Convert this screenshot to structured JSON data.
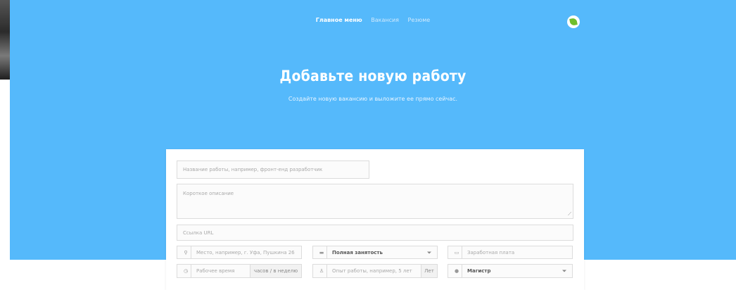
{
  "nav": {
    "items": [
      {
        "label": "Главное меню",
        "active": true
      },
      {
        "label": "Вакансия",
        "active": false
      },
      {
        "label": "Резюме",
        "active": false
      }
    ]
  },
  "logo": {
    "icon": "leaf-icon",
    "color": "#6fbe2c"
  },
  "hero": {
    "title": "Добавьте новую работу",
    "subtitle": "Создайте новую вакансию и выложите ее прямо сейчас.",
    "background": "#55b9fb"
  },
  "form": {
    "job_title": {
      "placeholder": "Название работы, например, фронт-енд разработчик"
    },
    "short_description": {
      "placeholder": "Короткое описание"
    },
    "url": {
      "placeholder": "Ссылка URL"
    },
    "location": {
      "icon": "map-marker-icon",
      "placeholder": "Место, например, г. Уфа, Пушкина 26"
    },
    "employment_type": {
      "icon": "briefcase-icon",
      "value": "Полная занятость"
    },
    "salary": {
      "icon": "money-icon",
      "placeholder": "Заработная плата"
    },
    "working_time": {
      "icon": "clock-icon",
      "placeholder": "Рабочее время",
      "unit": "часов / в неделю"
    },
    "experience": {
      "icon": "user-icon",
      "placeholder": "Опыт работы, например, 5 лет",
      "unit": "Лет"
    },
    "degree": {
      "icon": "graduation-icon",
      "value": "Магистр"
    }
  }
}
